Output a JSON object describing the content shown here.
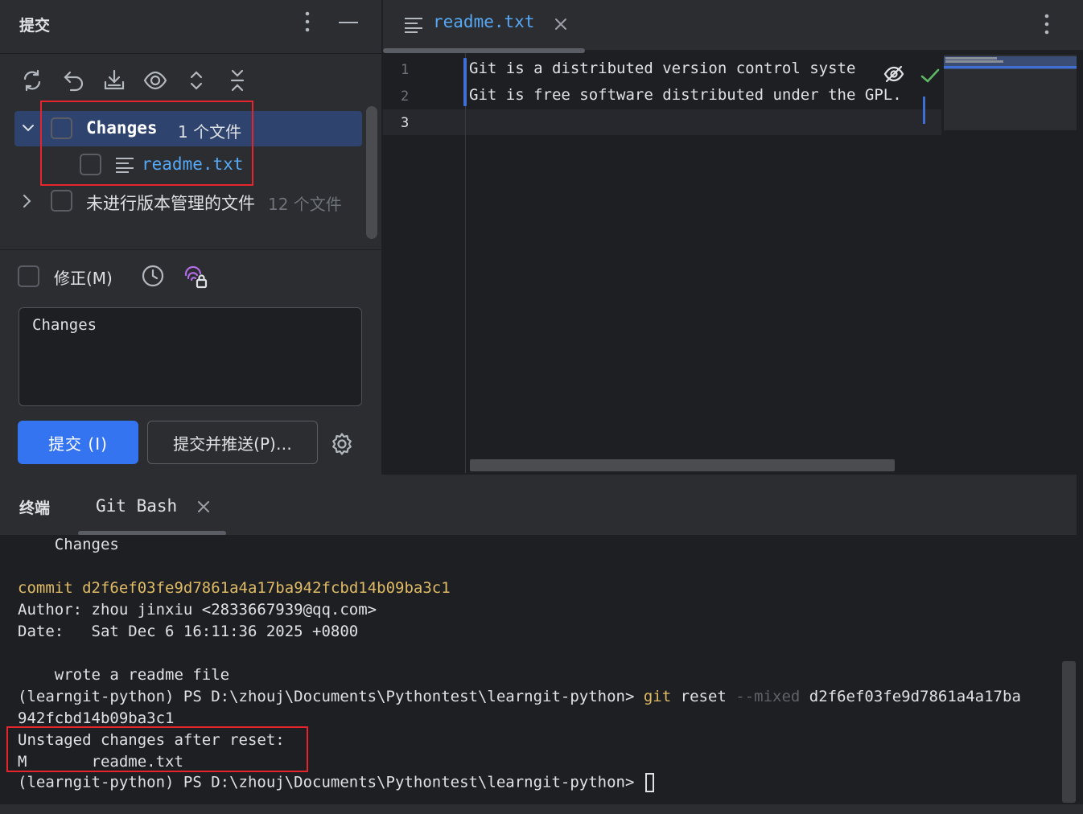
{
  "commit_panel": {
    "title": "提交",
    "more_icon": "more-vertical-icon",
    "minimize_icon": "minimize-icon",
    "toolbar": [
      "refresh-icon",
      "rollback-icon",
      "shelve-icon",
      "show-diff-icon",
      "expand-all-icon",
      "collapse-all-icon"
    ],
    "tree": {
      "changes": {
        "label": "Changes",
        "count": "1 个文件"
      },
      "file": {
        "label": "readme.txt"
      },
      "unversioned": {
        "label": "未进行版本管理的文件",
        "count": "12 个文件"
      }
    },
    "amend_label": "修正(M)",
    "commit_message": "Changes",
    "commit_button": "提交 (I)",
    "commit_push_button": "提交并推送(P)…"
  },
  "editor": {
    "tab_label": "readme.txt",
    "line_numbers": [
      "1",
      "2",
      "3"
    ],
    "lines": [
      "Git is a distributed version control syste",
      "Git is free software distributed under the GPL.",
      ""
    ]
  },
  "terminal": {
    "title": "终端",
    "tab_label": "Git Bash",
    "lines": {
      "l1": "    Changes",
      "commit_word": "commit",
      "commit_hash": "d2f6ef03fe9d7861a4a17ba942fcbd14b09ba3c1",
      "author": "Author: zhou jinxiu <2833667939@qq.com>",
      "date": "Date:   Sat Dec 6 16:11:36 2025 +0800",
      "message": "    wrote a readme file",
      "prompt": "(learngit-python) PS D:\\zhouj\\Documents\\Pythontest\\learngit-python> ",
      "cmd_git": "git",
      "cmd_reset": " reset ",
      "cmd_flag": "--mixed",
      "cmd_hash1": " d2f6ef03fe9d7861a4a17ba",
      "cmd_hash2": "942fcbd14b09ba3c1",
      "unstaged": "Unstaged changes after reset:",
      "modified": "M       readme.txt",
      "prompt2": "(learngit-python) PS D:\\zhouj\\Documents\\Pythontest\\learngit-python> "
    }
  }
}
